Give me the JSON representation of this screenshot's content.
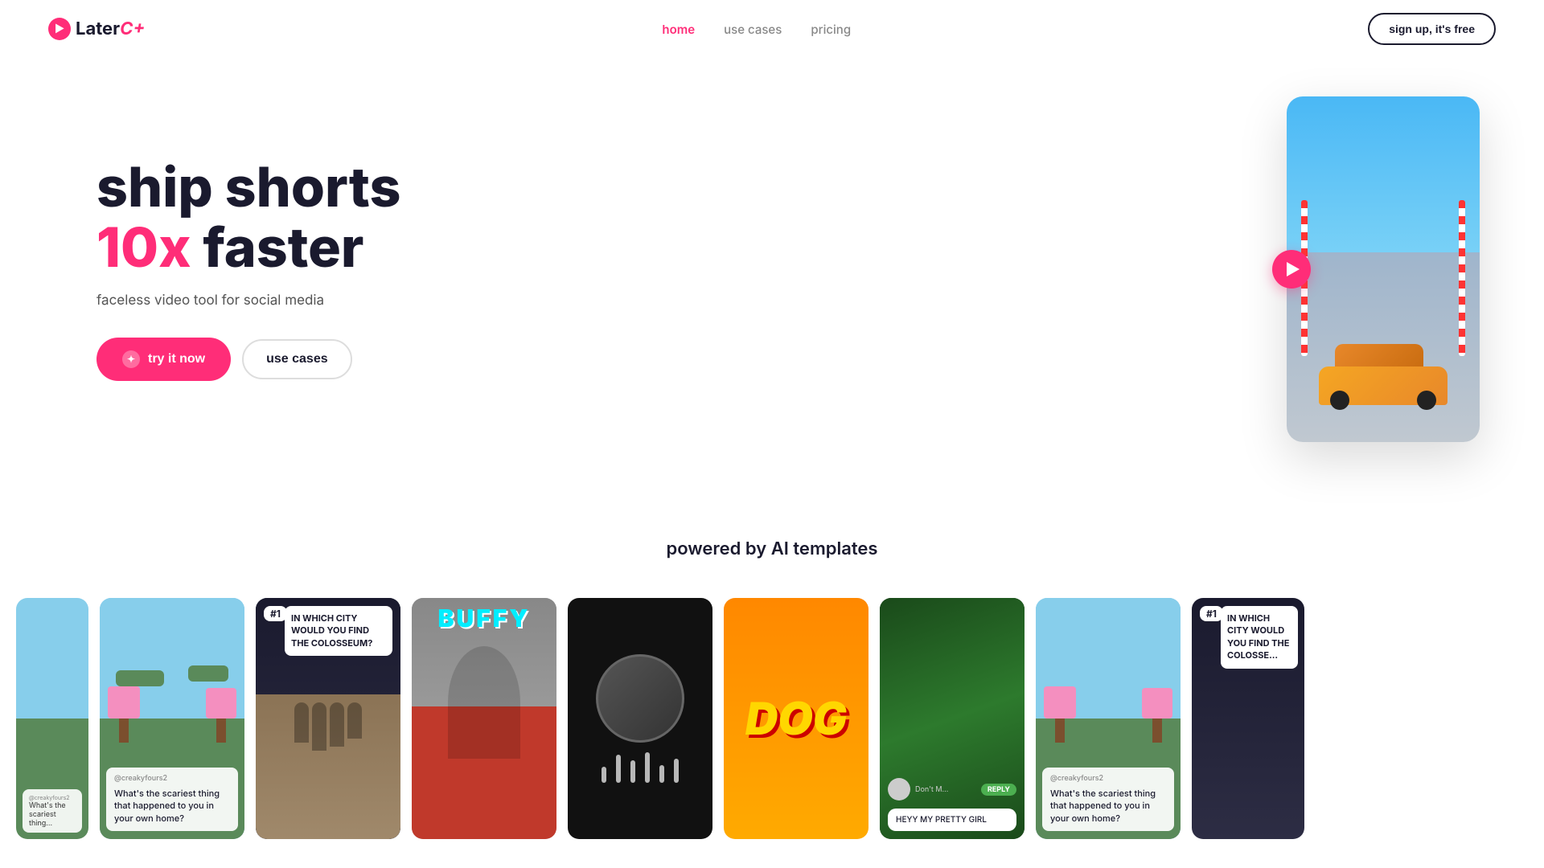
{
  "brand": {
    "name": "Later",
    "logo_icon": "▶",
    "logo_suffix": "C+"
  },
  "nav": {
    "links": [
      {
        "label": "home",
        "active": true
      },
      {
        "label": "use cases",
        "active": false
      },
      {
        "label": "pricing",
        "active": false
      }
    ],
    "cta_label": "sign up, it's free"
  },
  "hero": {
    "heading_line1": "ship shorts",
    "heading_highlight": "10x",
    "heading_line2": "faster",
    "subtitle": "faceless video tool for social media",
    "btn_primary": "try it now",
    "btn_secondary": "use cases"
  },
  "powered": {
    "title": "powered by AI templates"
  },
  "carousel": {
    "cards": [
      {
        "type": "minecraft",
        "id": "card-minecraft-partial"
      },
      {
        "type": "minecraft",
        "id": "card-minecraft",
        "credit": "@creakyfours2",
        "text": "What's the scariest thing that happened to you in your own home?"
      },
      {
        "type": "quiz",
        "badge": "#1",
        "question": "IN WHICH CITY WOULD YOU FIND THE COLOSSEUM?"
      },
      {
        "type": "face",
        "name": "BUFFY"
      },
      {
        "type": "podcast",
        "id": "card-podcast"
      },
      {
        "type": "dog",
        "text": "DOG"
      },
      {
        "type": "chat",
        "message": "HEYY MY PRETTY GIRL"
      },
      {
        "type": "minecraft2",
        "credit": "@creakyfours2",
        "text": "What's the scariest thing that happened to you in your own home?"
      },
      {
        "type": "quiz2",
        "badge": "#1",
        "question": "IN WHICH CITY WOULD YOU FIND THE COLOSSE..."
      }
    ]
  }
}
